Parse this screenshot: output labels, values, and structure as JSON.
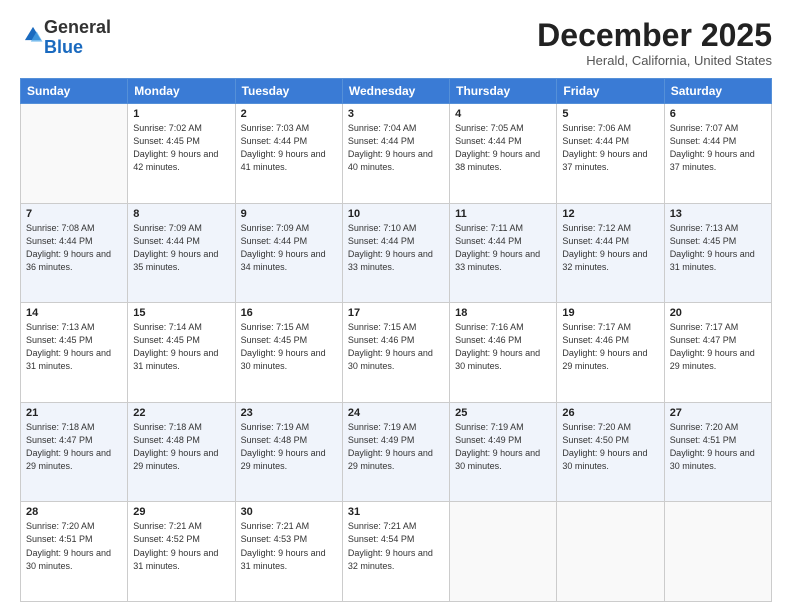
{
  "logo": {
    "general": "General",
    "blue": "Blue"
  },
  "header": {
    "month": "December 2025",
    "location": "Herald, California, United States"
  },
  "weekdays": [
    "Sunday",
    "Monday",
    "Tuesday",
    "Wednesday",
    "Thursday",
    "Friday",
    "Saturday"
  ],
  "weeks": [
    [
      {
        "day": "",
        "sunrise": "",
        "sunset": "",
        "daylight": ""
      },
      {
        "day": "1",
        "sunrise": "Sunrise: 7:02 AM",
        "sunset": "Sunset: 4:45 PM",
        "daylight": "Daylight: 9 hours and 42 minutes."
      },
      {
        "day": "2",
        "sunrise": "Sunrise: 7:03 AM",
        "sunset": "Sunset: 4:44 PM",
        "daylight": "Daylight: 9 hours and 41 minutes."
      },
      {
        "day": "3",
        "sunrise": "Sunrise: 7:04 AM",
        "sunset": "Sunset: 4:44 PM",
        "daylight": "Daylight: 9 hours and 40 minutes."
      },
      {
        "day": "4",
        "sunrise": "Sunrise: 7:05 AM",
        "sunset": "Sunset: 4:44 PM",
        "daylight": "Daylight: 9 hours and 38 minutes."
      },
      {
        "day": "5",
        "sunrise": "Sunrise: 7:06 AM",
        "sunset": "Sunset: 4:44 PM",
        "daylight": "Daylight: 9 hours and 37 minutes."
      },
      {
        "day": "6",
        "sunrise": "Sunrise: 7:07 AM",
        "sunset": "Sunset: 4:44 PM",
        "daylight": "Daylight: 9 hours and 37 minutes."
      }
    ],
    [
      {
        "day": "7",
        "sunrise": "Sunrise: 7:08 AM",
        "sunset": "Sunset: 4:44 PM",
        "daylight": "Daylight: 9 hours and 36 minutes."
      },
      {
        "day": "8",
        "sunrise": "Sunrise: 7:09 AM",
        "sunset": "Sunset: 4:44 PM",
        "daylight": "Daylight: 9 hours and 35 minutes."
      },
      {
        "day": "9",
        "sunrise": "Sunrise: 7:09 AM",
        "sunset": "Sunset: 4:44 PM",
        "daylight": "Daylight: 9 hours and 34 minutes."
      },
      {
        "day": "10",
        "sunrise": "Sunrise: 7:10 AM",
        "sunset": "Sunset: 4:44 PM",
        "daylight": "Daylight: 9 hours and 33 minutes."
      },
      {
        "day": "11",
        "sunrise": "Sunrise: 7:11 AM",
        "sunset": "Sunset: 4:44 PM",
        "daylight": "Daylight: 9 hours and 33 minutes."
      },
      {
        "day": "12",
        "sunrise": "Sunrise: 7:12 AM",
        "sunset": "Sunset: 4:44 PM",
        "daylight": "Daylight: 9 hours and 32 minutes."
      },
      {
        "day": "13",
        "sunrise": "Sunrise: 7:13 AM",
        "sunset": "Sunset: 4:45 PM",
        "daylight": "Daylight: 9 hours and 31 minutes."
      }
    ],
    [
      {
        "day": "14",
        "sunrise": "Sunrise: 7:13 AM",
        "sunset": "Sunset: 4:45 PM",
        "daylight": "Daylight: 9 hours and 31 minutes."
      },
      {
        "day": "15",
        "sunrise": "Sunrise: 7:14 AM",
        "sunset": "Sunset: 4:45 PM",
        "daylight": "Daylight: 9 hours and 31 minutes."
      },
      {
        "day": "16",
        "sunrise": "Sunrise: 7:15 AM",
        "sunset": "Sunset: 4:45 PM",
        "daylight": "Daylight: 9 hours and 30 minutes."
      },
      {
        "day": "17",
        "sunrise": "Sunrise: 7:15 AM",
        "sunset": "Sunset: 4:46 PM",
        "daylight": "Daylight: 9 hours and 30 minutes."
      },
      {
        "day": "18",
        "sunrise": "Sunrise: 7:16 AM",
        "sunset": "Sunset: 4:46 PM",
        "daylight": "Daylight: 9 hours and 30 minutes."
      },
      {
        "day": "19",
        "sunrise": "Sunrise: 7:17 AM",
        "sunset": "Sunset: 4:46 PM",
        "daylight": "Daylight: 9 hours and 29 minutes."
      },
      {
        "day": "20",
        "sunrise": "Sunrise: 7:17 AM",
        "sunset": "Sunset: 4:47 PM",
        "daylight": "Daylight: 9 hours and 29 minutes."
      }
    ],
    [
      {
        "day": "21",
        "sunrise": "Sunrise: 7:18 AM",
        "sunset": "Sunset: 4:47 PM",
        "daylight": "Daylight: 9 hours and 29 minutes."
      },
      {
        "day": "22",
        "sunrise": "Sunrise: 7:18 AM",
        "sunset": "Sunset: 4:48 PM",
        "daylight": "Daylight: 9 hours and 29 minutes."
      },
      {
        "day": "23",
        "sunrise": "Sunrise: 7:19 AM",
        "sunset": "Sunset: 4:48 PM",
        "daylight": "Daylight: 9 hours and 29 minutes."
      },
      {
        "day": "24",
        "sunrise": "Sunrise: 7:19 AM",
        "sunset": "Sunset: 4:49 PM",
        "daylight": "Daylight: 9 hours and 29 minutes."
      },
      {
        "day": "25",
        "sunrise": "Sunrise: 7:19 AM",
        "sunset": "Sunset: 4:49 PM",
        "daylight": "Daylight: 9 hours and 30 minutes."
      },
      {
        "day": "26",
        "sunrise": "Sunrise: 7:20 AM",
        "sunset": "Sunset: 4:50 PM",
        "daylight": "Daylight: 9 hours and 30 minutes."
      },
      {
        "day": "27",
        "sunrise": "Sunrise: 7:20 AM",
        "sunset": "Sunset: 4:51 PM",
        "daylight": "Daylight: 9 hours and 30 minutes."
      }
    ],
    [
      {
        "day": "28",
        "sunrise": "Sunrise: 7:20 AM",
        "sunset": "Sunset: 4:51 PM",
        "daylight": "Daylight: 9 hours and 30 minutes."
      },
      {
        "day": "29",
        "sunrise": "Sunrise: 7:21 AM",
        "sunset": "Sunset: 4:52 PM",
        "daylight": "Daylight: 9 hours and 31 minutes."
      },
      {
        "day": "30",
        "sunrise": "Sunrise: 7:21 AM",
        "sunset": "Sunset: 4:53 PM",
        "daylight": "Daylight: 9 hours and 31 minutes."
      },
      {
        "day": "31",
        "sunrise": "Sunrise: 7:21 AM",
        "sunset": "Sunset: 4:54 PM",
        "daylight": "Daylight: 9 hours and 32 minutes."
      },
      {
        "day": "",
        "sunrise": "",
        "sunset": "",
        "daylight": ""
      },
      {
        "day": "",
        "sunrise": "",
        "sunset": "",
        "daylight": ""
      },
      {
        "day": "",
        "sunrise": "",
        "sunset": "",
        "daylight": ""
      }
    ]
  ]
}
